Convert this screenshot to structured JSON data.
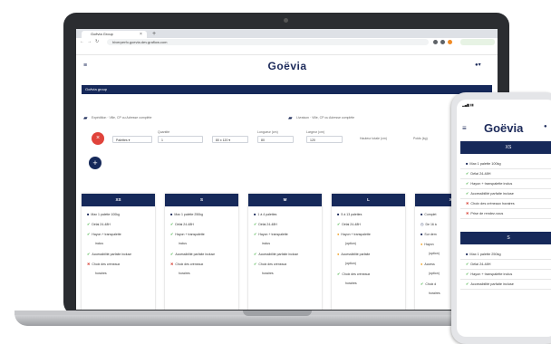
{
  "browser": {
    "tab_title": "Goëvia Group",
    "url": "hiverperfo.goevia.dev.graflow.com"
  },
  "app": {
    "logo": "Goëvia",
    "banner_title": "Goëvia group"
  },
  "form": {
    "departure": "Expédition · Ville, CP ou Adresse complète",
    "arrival": "Livraison · Ville, CP ou Adresse complète",
    "type_label": "Palettes",
    "qty_label": "Quantité",
    "qty_value": "1",
    "size_value": "80 x 120",
    "length_label": "Longueur (cm)",
    "length_value": "80",
    "width_label": "Largeur (cm)",
    "width_value": "120",
    "volume_label": "Hauteur totale (cm)",
    "weight_label": "Poids (kg)"
  },
  "cards": [
    {
      "title": "XS",
      "lines": [
        {
          "icon": "pallet",
          "text": "Max 1 palette 100kg"
        },
        {
          "icon": "check",
          "text": "Délai 24-48H"
        },
        {
          "icon": "check",
          "text": "Hayon + transpalette"
        },
        {
          "icon": "none",
          "text": "inclus"
        },
        {
          "icon": "check",
          "text": "Accessibilité parfaite incluse"
        },
        {
          "icon": "cross",
          "text": "Choix des créneaux"
        },
        {
          "icon": "none",
          "text": "horaires"
        }
      ]
    },
    {
      "title": "S",
      "lines": [
        {
          "icon": "pallet",
          "text": "Max 1 palette 250kg"
        },
        {
          "icon": "check",
          "text": "Délai 24-48H"
        },
        {
          "icon": "check",
          "text": "Hayon + transpalette"
        },
        {
          "icon": "none",
          "text": "inclus"
        },
        {
          "icon": "check",
          "text": "Accessibilité parfaite incluse"
        },
        {
          "icon": "cross",
          "text": "Choix des créneaux"
        },
        {
          "icon": "none",
          "text": "horaires"
        }
      ]
    },
    {
      "title": "M",
      "lines": [
        {
          "icon": "pallet",
          "text": "1 à 4 palettes"
        },
        {
          "icon": "check",
          "text": "Délai 24-48H"
        },
        {
          "icon": "check",
          "text": "Hayon + transpalette"
        },
        {
          "icon": "none",
          "text": "inclus"
        },
        {
          "icon": "check",
          "text": "Accessibilité parfaite incluse"
        },
        {
          "icon": "check",
          "text": "Choix des créneaux"
        },
        {
          "icon": "none",
          "text": "horaires"
        }
      ]
    },
    {
      "title": "L",
      "lines": [
        {
          "icon": "pallet",
          "text": "5 à 13 palettes"
        },
        {
          "icon": "check",
          "text": "Délai 24-48H"
        },
        {
          "icon": "warn",
          "text": "Hayon + transpalette"
        },
        {
          "icon": "none",
          "text": "(option)"
        },
        {
          "icon": "warn",
          "text": "Accessibilité parfaite"
        },
        {
          "icon": "none",
          "text": "(option)"
        },
        {
          "icon": "check",
          "text": "Choix des créneaux"
        },
        {
          "icon": "none",
          "text": "horaires"
        }
      ]
    },
    {
      "title": "XL",
      "lines": [
        {
          "icon": "pallet",
          "text": "Complet"
        },
        {
          "icon": "clock",
          "text": "De 16 à"
        },
        {
          "icon": "pallet",
          "text": "Sur dem"
        },
        {
          "icon": "warn",
          "text": "Hayon"
        },
        {
          "icon": "none",
          "text": "(option)"
        },
        {
          "icon": "warn",
          "text": "Access"
        },
        {
          "icon": "none",
          "text": "(option)"
        },
        {
          "icon": "check",
          "text": "Choix d"
        },
        {
          "icon": "none",
          "text": "horaires"
        }
      ]
    }
  ],
  "phone": {
    "time": "Goëvia",
    "logo": "Goëvia",
    "sections": [
      {
        "title": "XS",
        "lines": [
          {
            "icon": "pallet",
            "text": "Max 1 palette 100kg"
          },
          {
            "icon": "check",
            "text": "Délai 24-48H"
          },
          {
            "icon": "check",
            "text": "Hayon + transpalette inclus"
          },
          {
            "icon": "check",
            "text": "Accessibilité parfaite incluse"
          },
          {
            "icon": "cross",
            "text": "Choix des créneaux horaires"
          },
          {
            "icon": "cross",
            "text": "Prise de rendez-vous"
          }
        ]
      },
      {
        "title": "S",
        "lines": [
          {
            "icon": "pallet",
            "text": "Max 1 palette 250kg"
          },
          {
            "icon": "check",
            "text": "Délai 24-48H"
          },
          {
            "icon": "check",
            "text": "Hayon + transpalette inclus"
          },
          {
            "icon": "check",
            "text": "Accessibilité parfaite incluse"
          }
        ]
      }
    ]
  },
  "colors": {
    "navy": "#16295a",
    "check": "#3fae3f",
    "cross": "#d9463b",
    "warn": "#f0a020"
  }
}
